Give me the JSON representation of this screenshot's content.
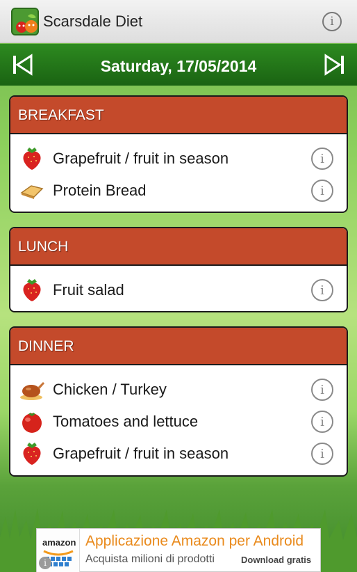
{
  "app": {
    "title": "Scarsdale Diet",
    "info_glyph": "i"
  },
  "nav": {
    "date": "Saturday, 17/05/2014",
    "prev_icon": "skip-previous-icon",
    "next_icon": "skip-next-icon"
  },
  "meals": [
    {
      "name": "BREAKFAST",
      "items": [
        {
          "label": "Grapefruit / fruit in season",
          "icon": "strawberry-icon"
        },
        {
          "label": "Protein Bread",
          "icon": "bread-icon"
        }
      ]
    },
    {
      "name": "LUNCH",
      "items": [
        {
          "label": "Fruit salad",
          "icon": "strawberry-icon"
        }
      ]
    },
    {
      "name": "DINNER",
      "items": [
        {
          "label": "Chicken / Turkey",
          "icon": "roast-chicken-icon"
        },
        {
          "label": "Tomatoes and lettuce",
          "icon": "tomato-icon"
        },
        {
          "label": "Grapefruit / fruit in season",
          "icon": "strawberry-icon"
        }
      ]
    }
  ],
  "ad": {
    "logo": "amazon",
    "title": "Applicazione Amazon per Android",
    "subtitle": "Acquista milioni di prodotti",
    "cta": "Download gratis",
    "badge": "i"
  },
  "colors": {
    "header_green": "#1f6f16",
    "meal_header": "#c44a2b",
    "ad_title": "#e98a1c"
  }
}
